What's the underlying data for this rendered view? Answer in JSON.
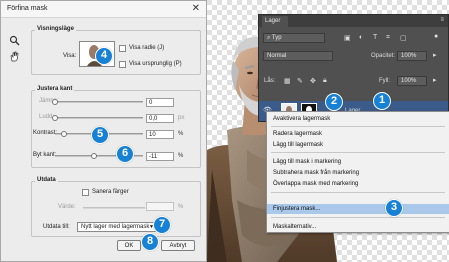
{
  "dialog": {
    "title": "Förfina mask",
    "close_glyph": "✕",
    "tools": [
      "zoom-icon",
      "hand-icon"
    ],
    "view_mode": {
      "group_title": "Visningsläge",
      "view_label": "Visa:",
      "show_radius_label": "Visa radie (J)",
      "show_original_label": "Visa ursprunglig (P)"
    },
    "edge_adjust": {
      "group_title": "Justera kant",
      "sliders": [
        {
          "label": "Jämna:",
          "value": "0",
          "unit": "",
          "fraction": 0.0,
          "dim": true
        },
        {
          "label": "Ludd:",
          "value": "0,0",
          "unit": "px",
          "fraction": 0.0,
          "dim": true
        },
        {
          "label": "Kontrast:",
          "value": "10",
          "unit": "%",
          "fraction": 0.1,
          "dim": false
        },
        {
          "label": "Byt kant:",
          "value": "-11",
          "unit": "%",
          "fraction": 0.445,
          "dim": false
        }
      ]
    },
    "output": {
      "group_title": "Utdata",
      "decontaminate_label": "Sanera färger",
      "amount_label": "Värde:",
      "amount_unit": "%",
      "output_to_label": "Utdata till:",
      "output_to_value": "Nytt lager med lagermask"
    },
    "buttons": {
      "ok": "OK",
      "cancel": "Avbryt"
    }
  },
  "layers_panel": {
    "tab": "Lager",
    "filter_kind": "Typ",
    "blend_mode": "Normal",
    "opacity_label": "Opacitet:",
    "opacity_value": "100%",
    "lock_label": "Lås:",
    "fill_label": "Fyll:",
    "fill_value": "100%",
    "layer_name": "Lager"
  },
  "context_menu": {
    "items": [
      {
        "label": "Avaktivera lagermask",
        "highlighted": false
      },
      {
        "label": "Radera lagermask",
        "highlighted": false
      },
      {
        "label": "Lägg till lagermask",
        "highlighted": false
      },
      {
        "label": "Lägg till mask i markering",
        "highlighted": false
      },
      {
        "label": "Subtrahera mask från markering",
        "highlighted": false
      },
      {
        "label": "Överlappa mask med markering",
        "highlighted": false
      },
      {
        "label": "Finjustera mask...",
        "highlighted": true
      },
      {
        "label": "Maskalternativ...",
        "highlighted": false
      }
    ]
  },
  "badges": [
    "1",
    "2",
    "3",
    "4",
    "5",
    "6",
    "7",
    "8"
  ],
  "colors": {
    "badge": "#1781d6",
    "menu_highlight": "#a9c8ea",
    "layer_selected": "#3b5b8a",
    "dialog_bg": "#ececec",
    "panel_bg": "#505050"
  }
}
